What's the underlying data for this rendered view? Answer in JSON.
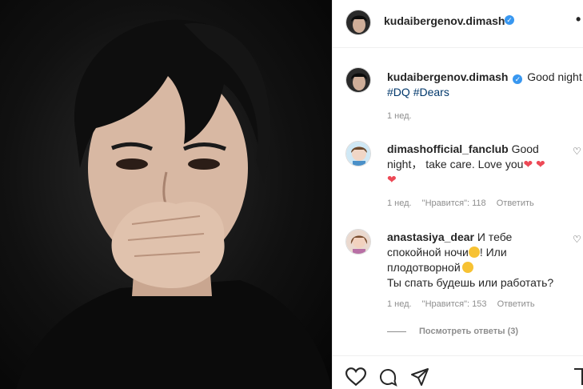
{
  "post": {
    "username": "kudaibergenov.dimash",
    "caption": "Good night!",
    "hashtags": [
      "#DQ",
      "#Dears"
    ],
    "time": "1 нед."
  },
  "comments": [
    {
      "username": "dimashofficial_fanclub",
      "text_line1": "Good",
      "text_line2": "night， take care. Love you",
      "time": "1 нед.",
      "likes": "\"Нравится\": 118",
      "reply": "Ответить"
    },
    {
      "username": "anastasiya_dear",
      "text_line1": "И тебе",
      "text_line2": "спокойной ночи",
      "text_line2b": "! Или",
      "text_line3": "плодотворной",
      "text_line4": "Ты спать будешь или работать?",
      "time": "1 нед.",
      "likes": "\"Нравится\": 153",
      "reply": "Ответить"
    }
  ],
  "view_replies": "Посмотреть ответы (3)",
  "icons": {
    "header_more": "•"
  },
  "colors": {
    "verified": "#3897f0",
    "hashtag": "#00376b",
    "like_heart": "#ed4956"
  }
}
